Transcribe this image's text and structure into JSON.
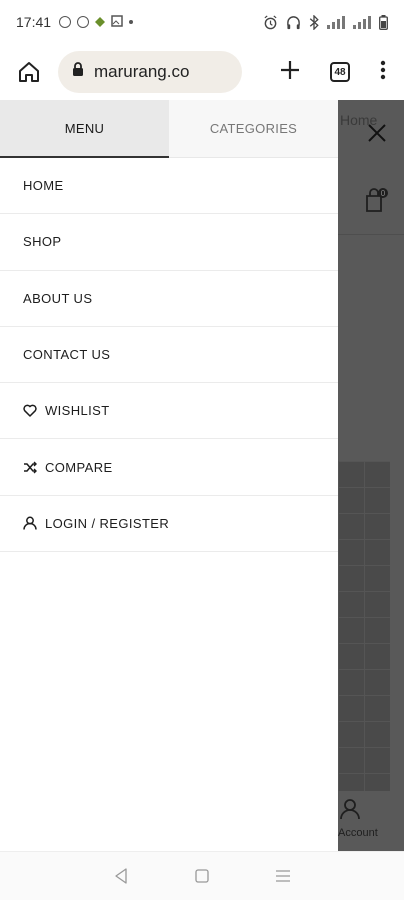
{
  "status_bar": {
    "time": "17:41",
    "left_icons": [
      "instagram-icon",
      "whatsapp-icon",
      "location-icon",
      "gallery-icon",
      "dot-icon"
    ],
    "right_icons": [
      "alarm-icon",
      "headphones-icon",
      "bluetooth-icon",
      "signal-icon",
      "signal-icon",
      "battery-icon"
    ]
  },
  "browser": {
    "url": "marurang.co",
    "tab_count": "48",
    "home_icon": "home-icon",
    "lock_icon": "lock-icon",
    "new_tab_icon": "plus-icon",
    "menu_icon": "kebab-icon"
  },
  "background_page": {
    "home_text": "Home",
    "cart_count": "0",
    "account_label": "Account"
  },
  "drawer": {
    "tabs": [
      {
        "label": "MENU",
        "active": true
      },
      {
        "label": "CATEGORIES",
        "active": false
      }
    ],
    "items": [
      {
        "label": "HOME",
        "icon": null
      },
      {
        "label": "SHOP",
        "icon": null
      },
      {
        "label": "ABOUT US",
        "icon": null
      },
      {
        "label": "CONTACT US",
        "icon": null
      },
      {
        "label": "WISHLIST",
        "icon": "heart-icon"
      },
      {
        "label": "COMPARE",
        "icon": "shuffle-icon"
      },
      {
        "label": "LOGIN / REGISTER",
        "icon": "user-icon"
      }
    ]
  },
  "nav_bar": {
    "buttons": [
      "back-icon",
      "home-square-icon",
      "recents-icon"
    ]
  },
  "colors": {
    "overlay": "#595959",
    "url_pill": "#f1ede7",
    "active_tab": "#e9e9e9"
  }
}
